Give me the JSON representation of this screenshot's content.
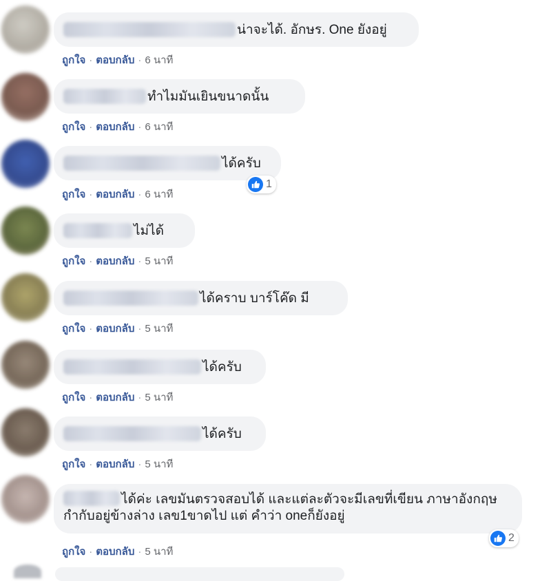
{
  "actions": {
    "like": "ถูกใจ",
    "reply": "ตอบกลับ",
    "separator": "·"
  },
  "comments": [
    {
      "text": "น่าจะได้. อักษร. One ยังอยู่",
      "time": "6 นาที"
    },
    {
      "text": "ทำไมมันเยินขนาดนั้น",
      "time": "6 นาที"
    },
    {
      "text": "ได้ครับ",
      "time": "6 นาที",
      "reactions": "1"
    },
    {
      "text": "ไม่ได้",
      "time": "5 นาที"
    },
    {
      "text": "ได้คราบ บาร์โค๊ด มี",
      "time": "5 นาที"
    },
    {
      "text": "ได้ครับ",
      "time": "5 นาที"
    },
    {
      "text": "ได้ครับ",
      "time": "5 นาที"
    },
    {
      "text": "ได้ค่ะ เลขมันตรวจสอบได้ และแต่ละตัวจะมีเลขที่เขียน ภาษาอังกฤษกำกับอยู่ข้างล่าง เลข1ขาดไป แต่ คำว่า oneก็ยังอยู่",
      "time": "5 นาที",
      "reactions": "2"
    }
  ],
  "colors": {
    "link": "#385898",
    "bubble": "#f2f3f5",
    "like_blue": "#1877f2"
  },
  "icons": {
    "reaction": "thumbs-up-icon"
  }
}
